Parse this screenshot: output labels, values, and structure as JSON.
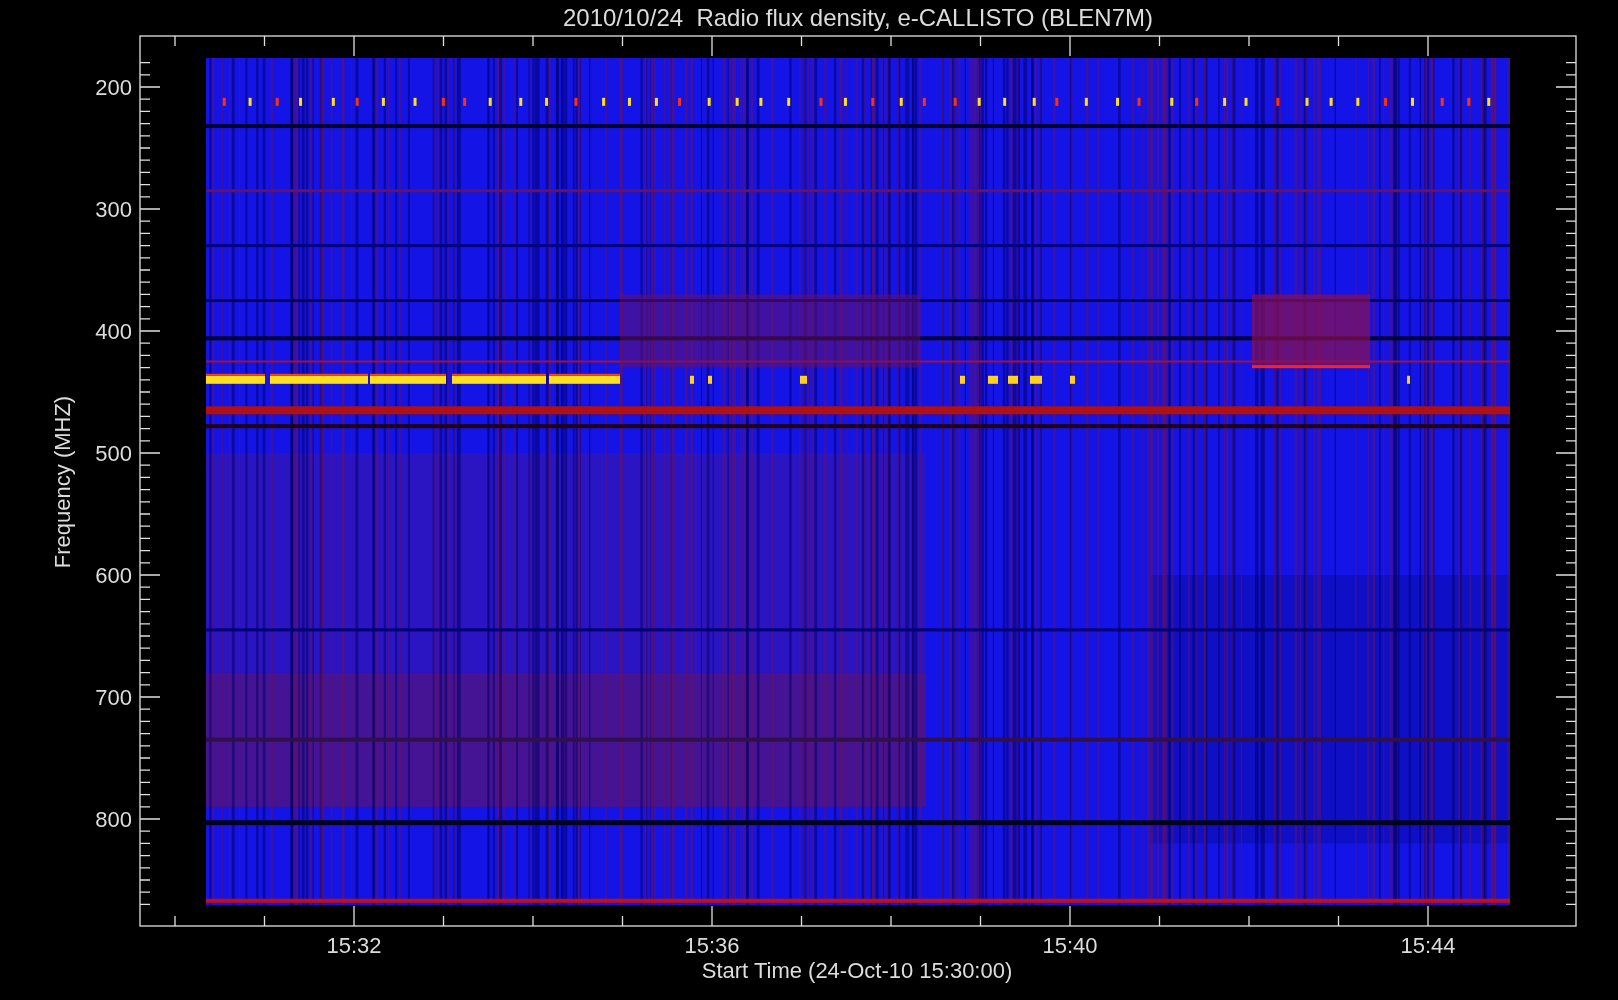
{
  "title": "2010/10/24  Radio flux density, e-CALLISTO (BLEN7M)",
  "y_axis": {
    "label": "Frequency (MHZ)",
    "ticks": [
      "200",
      "300",
      "400",
      "500",
      "600",
      "700",
      "800"
    ]
  },
  "x_axis": {
    "label": "Start Time (24-Oct-10 15:30:00)",
    "ticks": [
      "15:32",
      "15:36",
      "15:40",
      "15:44"
    ]
  }
}
